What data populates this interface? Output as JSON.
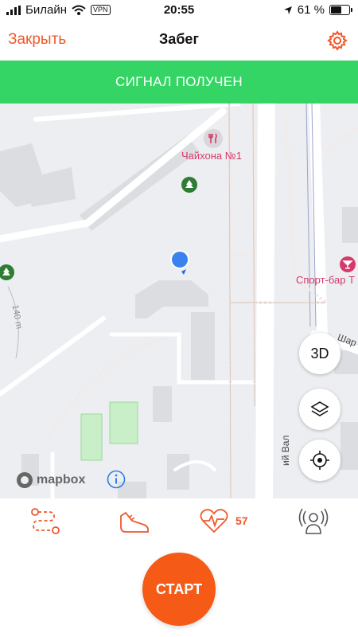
{
  "status_bar": {
    "carrier": "Билайн",
    "vpn": "VPN",
    "time": "20:55",
    "battery": "61 %",
    "battery_level": 0.61
  },
  "nav": {
    "close_label": "Закрыть",
    "title": "Забег",
    "settings_icon": "gear-icon"
  },
  "banner": {
    "text": "СИГНАЛ ПОЛУЧЕН",
    "color": "#35d565"
  },
  "map": {
    "pois": [
      {
        "name": "Чайхона №1",
        "icon": "restaurant-icon"
      },
      {
        "name": "Спорт-бар Т",
        "icon": "cocktail-icon"
      }
    ],
    "streets": [
      "ий Вал",
      "Шар"
    ],
    "scale_label": "140 m",
    "buttons": {
      "three_d": "3D",
      "layers_icon": "layers-icon",
      "locate_icon": "target-icon"
    },
    "attribution": "mapbox",
    "info_icon": "info-icon"
  },
  "tabbar": {
    "route_icon": "route-icon",
    "shoe_icon": "sneaker-icon",
    "heart_icon": "heart-rate-icon",
    "heart_rate": "57",
    "sensor_icon": "sensor-icon"
  },
  "start_button": {
    "label": "СТАРТ",
    "color": "#f55a16"
  },
  "accent_color": "#f0582a"
}
